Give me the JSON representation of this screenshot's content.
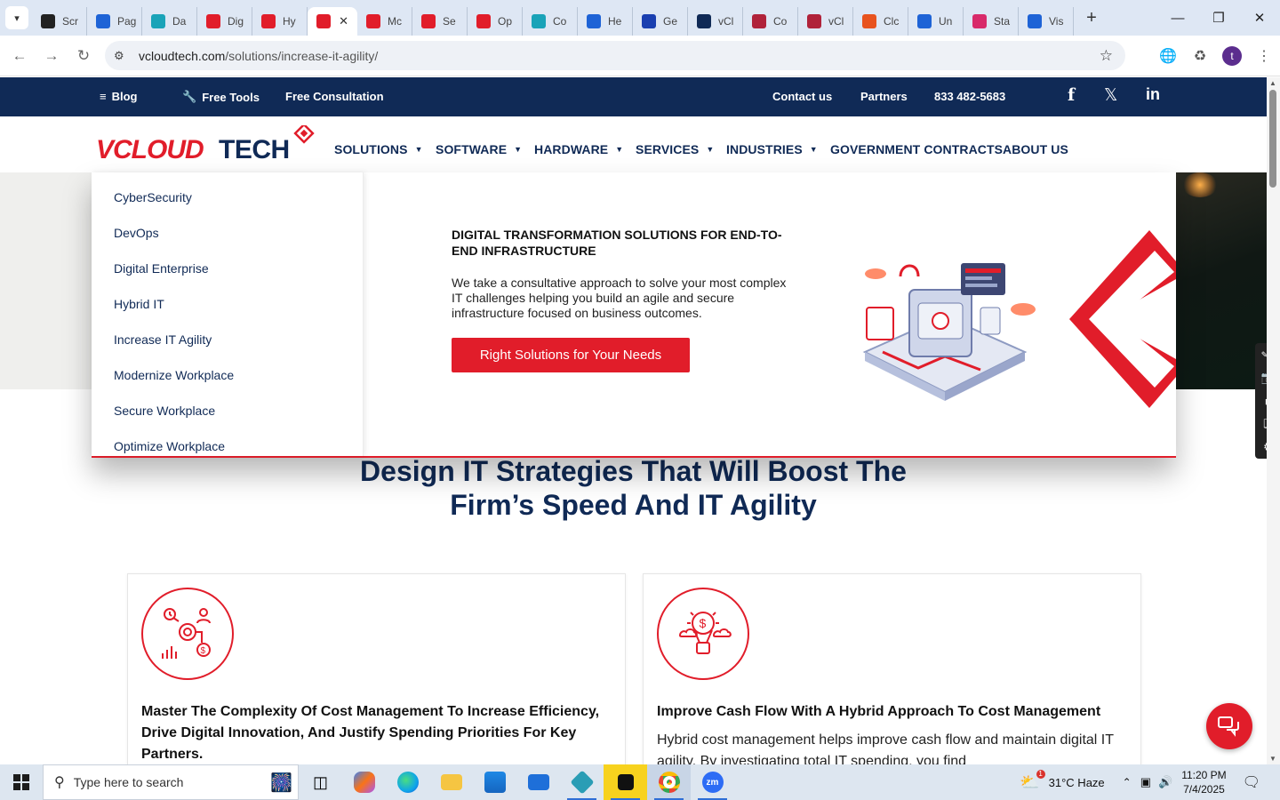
{
  "browser": {
    "tabs": [
      {
        "label": "Scr",
        "color": "#222"
      },
      {
        "label": "Pag",
        "color": "#1e63d6"
      },
      {
        "label": "Da",
        "color": "#1aa3b8"
      },
      {
        "label": "Dig",
        "color": "#e11d2a"
      },
      {
        "label": "Hy",
        "color": "#e11d2a"
      },
      {
        "label": "",
        "color": "#e11d2a",
        "active": true
      },
      {
        "label": "Mc",
        "color": "#e11d2a"
      },
      {
        "label": "Se",
        "color": "#e11d2a"
      },
      {
        "label": "Op",
        "color": "#e11d2a"
      },
      {
        "label": "Co",
        "color": "#1aa3b8"
      },
      {
        "label": "He",
        "color": "#1e63d6"
      },
      {
        "label": "Ge",
        "color": "#1a3fb0"
      },
      {
        "label": "vCl",
        "color": "#102a56"
      },
      {
        "label": "Co",
        "color": "#b0223a"
      },
      {
        "label": "vCl",
        "color": "#b0223a"
      },
      {
        "label": "Clc",
        "color": "#e8531e"
      },
      {
        "label": "Un",
        "color": "#1e63d6"
      },
      {
        "label": "Sta",
        "color": "#d82a6a"
      },
      {
        "label": "Vis",
        "color": "#1e63d6"
      }
    ],
    "url_host": "vcloudtech.com",
    "url_path": "/solutions/increase-it-agility/",
    "avatar_letter": "t"
  },
  "site": {
    "topbar": {
      "blog": "Blog",
      "free_tools": "Free Tools",
      "free_consultation": "Free Consultation",
      "contact": "Contact us",
      "partners": "Partners",
      "phone": "833 482-5683"
    },
    "logo_text": "VCLOUD TECH",
    "nav": {
      "solutions": "SOLUTIONS",
      "software": "SOFTWARE",
      "hardware": "HARDWARE",
      "services": "SERVICES",
      "industries": "INDUSTRIES",
      "government": "GOVERNMENT CONTRACTS",
      "about": "ABOUT US"
    },
    "mega_menu": {
      "items": [
        "CyberSecurity",
        "DevOps",
        "Digital Enterprise",
        "Hybrid IT",
        "Increase IT Agility",
        "Modernize Workplace",
        "Secure Workplace",
        "Optimize Workplace"
      ],
      "title": "DIGITAL TRANSFORMATION SOLUTIONS FOR END-TO-END INFRASTRUCTURE",
      "description": "We take a consultative approach to solve your most complex IT challenges helping you build an agile and secure infrastructure focused on business outcomes.",
      "button": "Right Solutions for Your Needs"
    },
    "headline": "Design IT Strategies That Will Boost The Firm’s Speed And IT Agility",
    "cards": [
      {
        "title": "Master The Complexity Of Cost Management To Increase Efficiency, Drive Digital Innovation, And Justify Spending Priorities For Key Partners.",
        "text": ""
      },
      {
        "title": "Improve Cash Flow With A Hybrid Approach To Cost Management",
        "text": "Hybrid cost management helps improve cash flow and maintain digital IT agility. By investigating total IT spending, you find"
      }
    ]
  },
  "taskbar": {
    "search_placeholder": "Type here to search",
    "weather": "31°C  Haze",
    "weather_badge": "1",
    "time": "11:20 PM",
    "date": "7/4/2025"
  },
  "colors": {
    "navy": "#102a56",
    "red": "#e11d2a"
  }
}
